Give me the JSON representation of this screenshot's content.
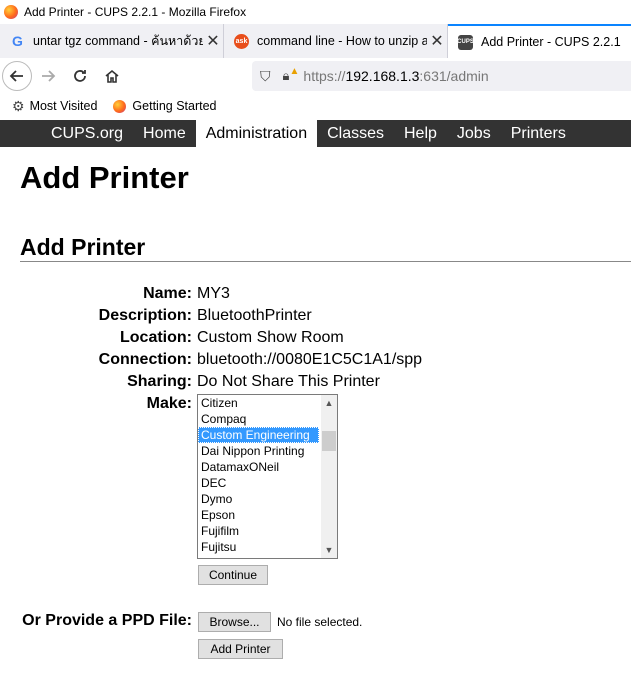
{
  "window": {
    "title": "Add Printer - CUPS 2.2.1 - Mozilla Firefox"
  },
  "tabs": [
    {
      "label": "untar tgz command - ค้นหาด้วย G",
      "favicon": "google-icon"
    },
    {
      "label": "command line - How to unzip a",
      "favicon": "ask-icon",
      "favicon_text": "ask"
    },
    {
      "label": "Add Printer - CUPS 2.2.1",
      "favicon": "cups-icon",
      "favicon_text": "CUPS"
    }
  ],
  "nav": {
    "url_prefix": "https://",
    "url_host": "192.168.1.3",
    "url_rest": ":631/admin"
  },
  "bookmarks": [
    {
      "label": "Most Visited",
      "icon": "gear-icon"
    },
    {
      "label": "Getting Started",
      "icon": "firefox-icon"
    }
  ],
  "cups_menu": [
    "CUPS.org",
    "Home",
    "Administration",
    "Classes",
    "Help",
    "Jobs",
    "Printers"
  ],
  "page": {
    "title": "Add Printer",
    "section_title": "Add Printer",
    "fields": [
      {
        "label": "Name:",
        "value": "MY3"
      },
      {
        "label": "Description:",
        "value": "BluetoothPrinter"
      },
      {
        "label": "Location:",
        "value": "Custom Show Room"
      },
      {
        "label": "Connection:",
        "value": "bluetooth://0080E1C5C1A1/spp"
      },
      {
        "label": "Sharing:",
        "value": "Do Not Share This Printer"
      }
    ],
    "make_label": "Make:",
    "make_options": [
      "Citizen",
      "Compaq",
      "Custom Engineering",
      "Dai Nippon Printing",
      "DatamaxONeil",
      "DEC",
      "Dymo",
      "Epson",
      "Fujifilm",
      "Fujitsu"
    ],
    "make_selected": "Custom Engineering",
    "continue_label": "Continue",
    "ppd_label": "Or Provide a PPD File:",
    "browse_label": "Browse...",
    "no_file_text": "No file selected.",
    "add_printer_label": "Add Printer"
  },
  "colors": {
    "accent": "#0a84ff",
    "menu_bg": "#333333",
    "selection": "#3399ff"
  }
}
